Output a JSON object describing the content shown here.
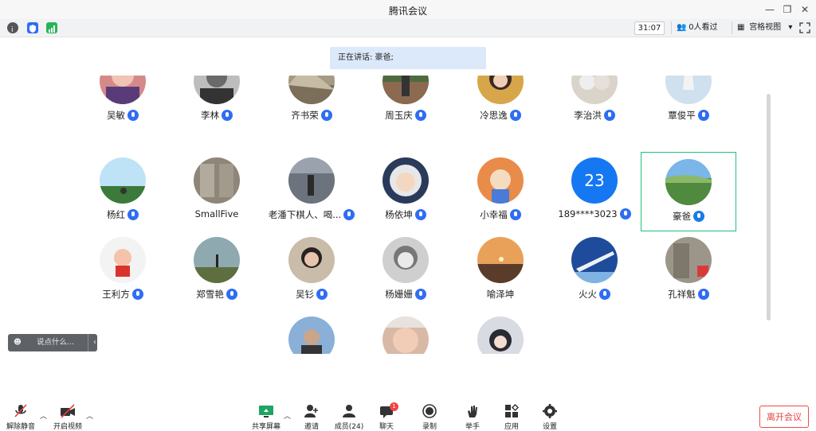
{
  "window": {
    "title": "腾讯会议"
  },
  "statusbar": {
    "timer": "31:07",
    "viewers": "0人看过",
    "view_mode": "宫格视图"
  },
  "speaking": "正在讲话: 豪爸;",
  "participants_rows": [
    [
      "吴敏",
      "李林",
      "齐书荣",
      "周玉庆",
      "冷思逸",
      "李治洪",
      "覃俊平"
    ],
    [
      "杨红",
      "SmallFive",
      "老潘下棋人、喝...",
      "杨依坤",
      "小幸福",
      "189****3023",
      "豪爸"
    ],
    [
      "王利方",
      "郑雪艳",
      "吴钐",
      "杨姗姗",
      "喻泽坤",
      "火火",
      "孔祥魁"
    ]
  ],
  "number_avatar": "23",
  "chat": {
    "placeholder": "说点什么..."
  },
  "toolbar": {
    "unmute": "解除静音",
    "video": "开启视频",
    "share": "共享屏幕",
    "invite": "邀请",
    "members": "成员(24)",
    "chat": "聊天",
    "chat_badge": "1",
    "record": "录制",
    "raise_hand": "举手",
    "apps": "应用",
    "settings": "设置",
    "leave": "离开会议"
  }
}
